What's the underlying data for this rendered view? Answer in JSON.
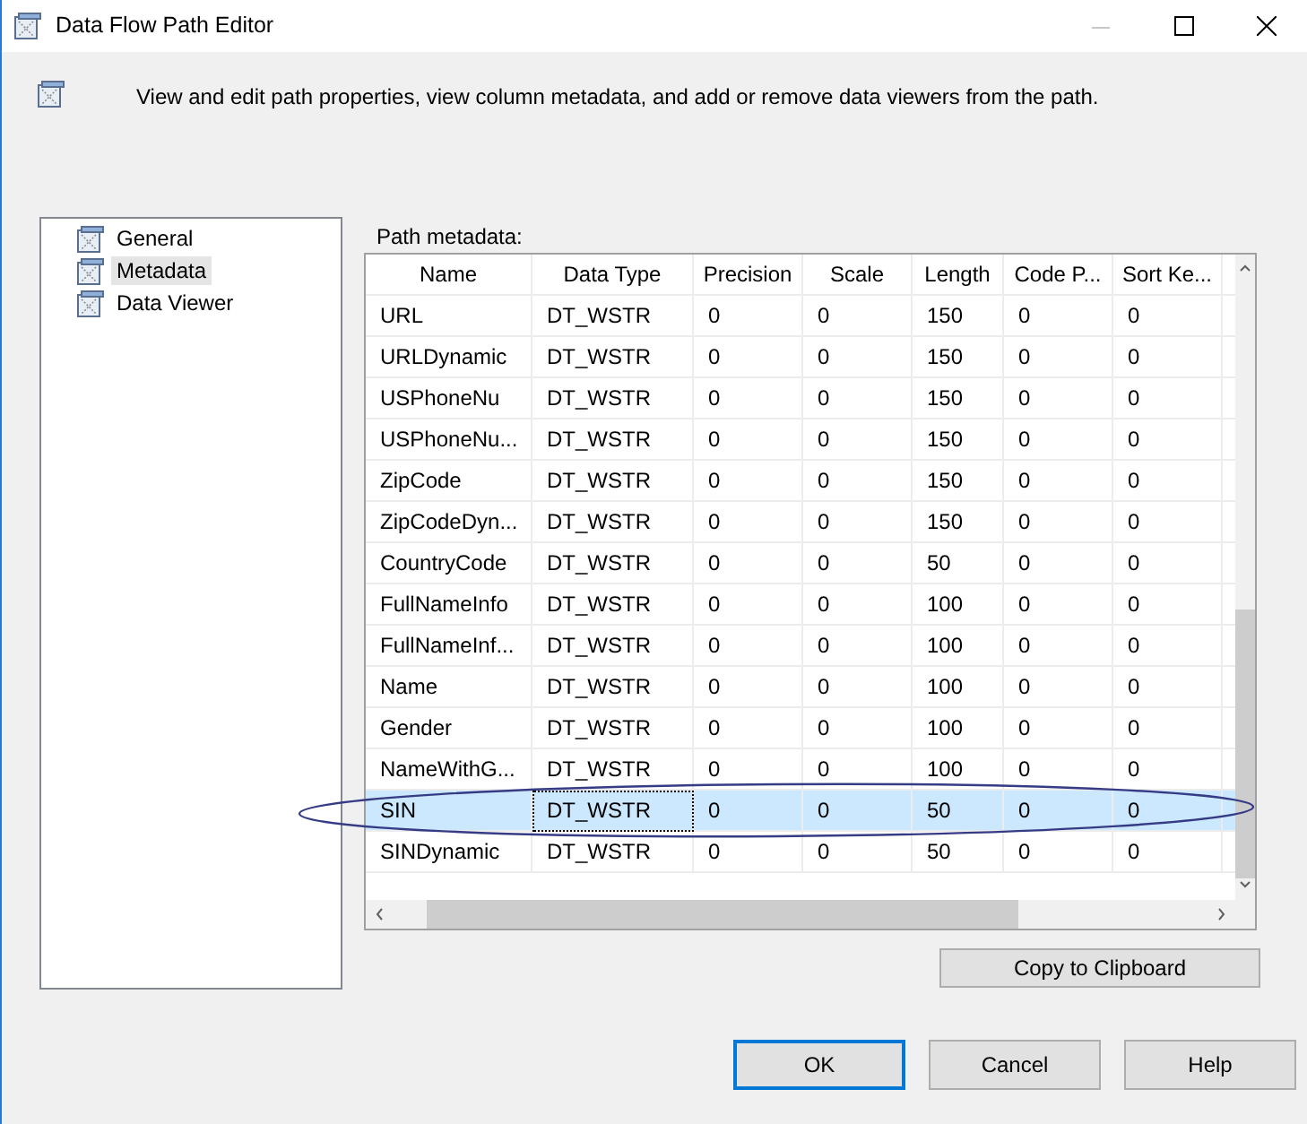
{
  "window": {
    "title": "Data Flow Path Editor"
  },
  "description": "View and edit path properties, view column metadata, and add or remove data viewers from the path.",
  "sidebar": {
    "items": [
      {
        "label": "General",
        "selected": false
      },
      {
        "label": "Metadata",
        "selected": true
      },
      {
        "label": "Data Viewer",
        "selected": false
      }
    ]
  },
  "table": {
    "label": "Path metadata:",
    "columns": [
      "Name",
      "Data Type",
      "Precision",
      "Scale",
      "Length",
      "Code P...",
      "Sort Ke..."
    ],
    "rows": [
      {
        "cells": [
          "URL",
          "DT_WSTR",
          "0",
          "0",
          "150",
          "0",
          "0"
        ],
        "selected": false
      },
      {
        "cells": [
          "URLDynamic",
          "DT_WSTR",
          "0",
          "0",
          "150",
          "0",
          "0"
        ],
        "selected": false
      },
      {
        "cells": [
          "USPhoneNu",
          "DT_WSTR",
          "0",
          "0",
          "150",
          "0",
          "0"
        ],
        "selected": false
      },
      {
        "cells": [
          "USPhoneNu...",
          "DT_WSTR",
          "0",
          "0",
          "150",
          "0",
          "0"
        ],
        "selected": false
      },
      {
        "cells": [
          "ZipCode",
          "DT_WSTR",
          "0",
          "0",
          "150",
          "0",
          "0"
        ],
        "selected": false
      },
      {
        "cells": [
          "ZipCodeDyn...",
          "DT_WSTR",
          "0",
          "0",
          "150",
          "0",
          "0"
        ],
        "selected": false
      },
      {
        "cells": [
          "CountryCode",
          "DT_WSTR",
          "0",
          "0",
          "50",
          "0",
          "0"
        ],
        "selected": false
      },
      {
        "cells": [
          "FullNameInfo",
          "DT_WSTR",
          "0",
          "0",
          "100",
          "0",
          "0"
        ],
        "selected": false
      },
      {
        "cells": [
          "FullNameInf...",
          "DT_WSTR",
          "0",
          "0",
          "100",
          "0",
          "0"
        ],
        "selected": false
      },
      {
        "cells": [
          "Name",
          "DT_WSTR",
          "0",
          "0",
          "100",
          "0",
          "0"
        ],
        "selected": false
      },
      {
        "cells": [
          "Gender",
          "DT_WSTR",
          "0",
          "0",
          "100",
          "0",
          "0"
        ],
        "selected": false
      },
      {
        "cells": [
          "NameWithG...",
          "DT_WSTR",
          "0",
          "0",
          "100",
          "0",
          "0"
        ],
        "selected": false
      },
      {
        "cells": [
          "SIN",
          "DT_WSTR",
          "0",
          "0",
          "50",
          "0",
          "0"
        ],
        "selected": true
      },
      {
        "cells": [
          "SINDynamic",
          "DT_WSTR",
          "0",
          "0",
          "50",
          "0",
          "0"
        ],
        "selected": false
      }
    ]
  },
  "copy_button": "Copy to Clipboard",
  "buttons": [
    "OK",
    "Cancel",
    "Help"
  ]
}
